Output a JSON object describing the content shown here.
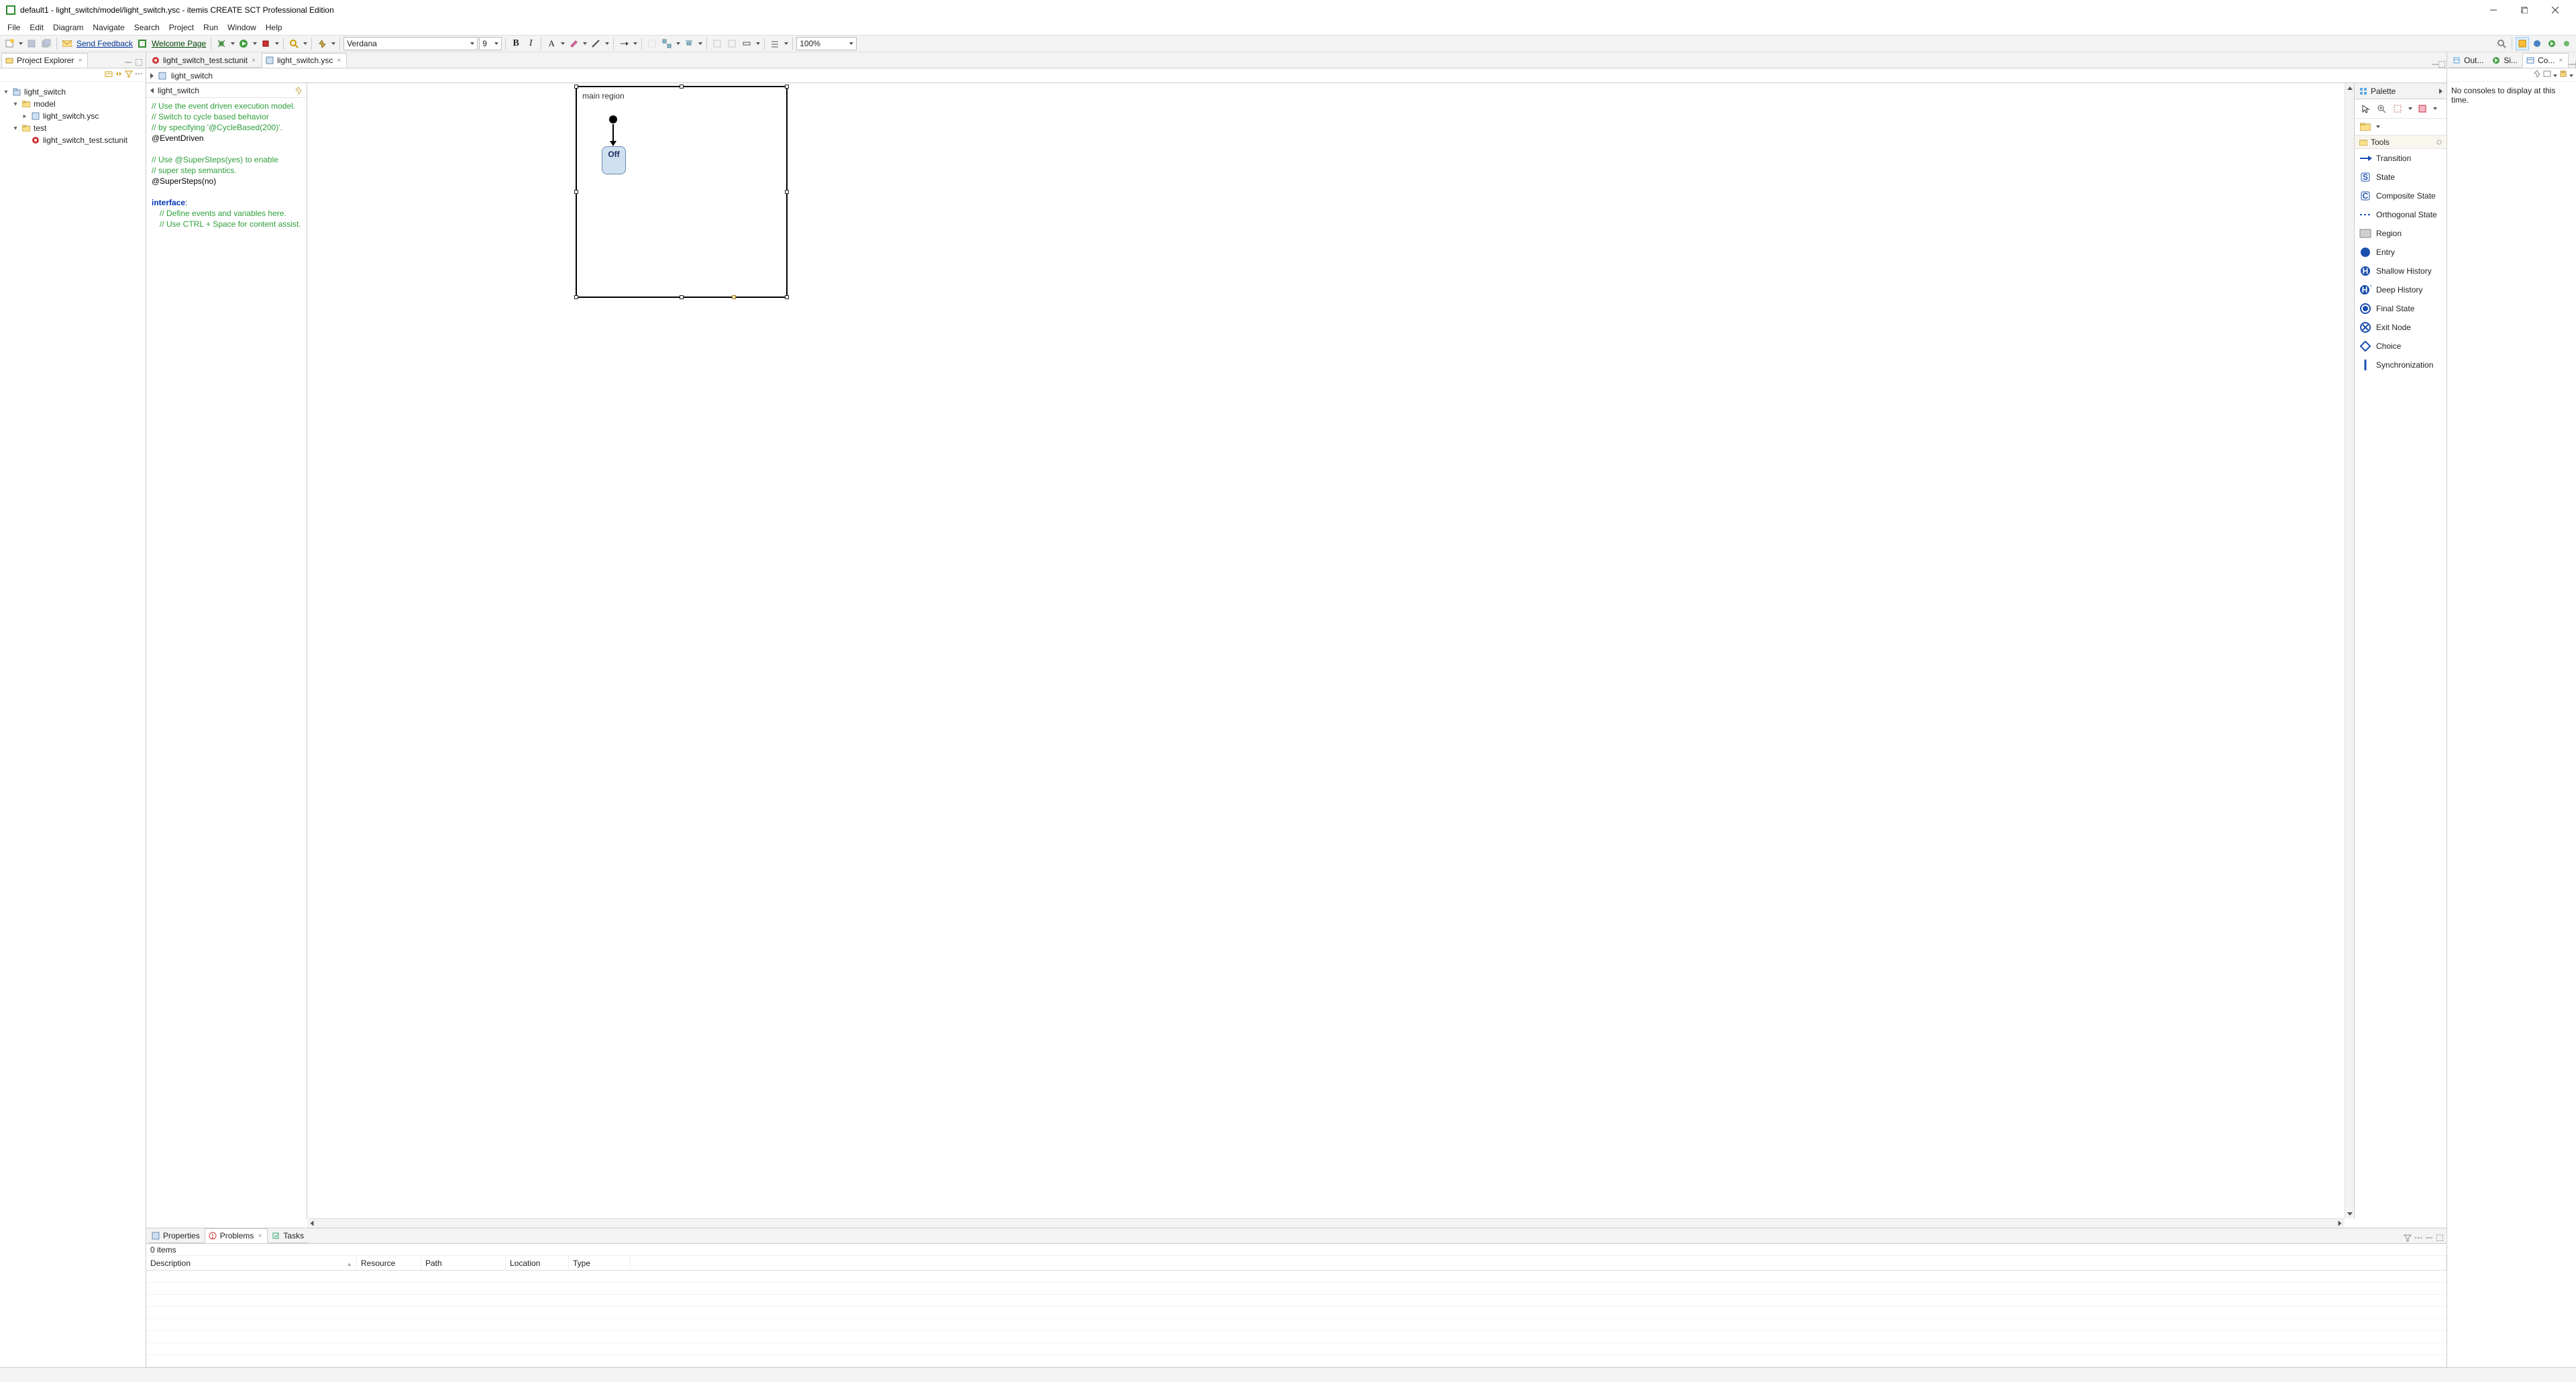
{
  "window": {
    "title": "default1 - light_switch/model/light_switch.ysc - itemis CREATE SCT Professional Edition"
  },
  "menus": [
    "File",
    "Edit",
    "Diagram",
    "Navigate",
    "Search",
    "Project",
    "Run",
    "Window",
    "Help"
  ],
  "toolbar": {
    "send_feedback": "Send Feedback",
    "welcome_page": "Welcome Page",
    "font_family": "Verdana",
    "font_size": "9",
    "zoom": "100%"
  },
  "explorer": {
    "tab": "Project Explorer",
    "tree": {
      "project": "light_switch",
      "folders": [
        {
          "name": "model",
          "children": [
            "light_switch.ysc"
          ]
        },
        {
          "name": "test",
          "children": [
            "light_switch_test.sctunit"
          ]
        }
      ]
    }
  },
  "editor": {
    "tabs": [
      {
        "label": "light_switch_test.sctunit",
        "active": false
      },
      {
        "label": "light_switch.ysc",
        "active": true
      }
    ],
    "breadcrumb": "light_switch",
    "defhead": "light_switch",
    "definition": {
      "lines": [
        {
          "kind": "c",
          "text": "// Use the event driven execution model."
        },
        {
          "kind": "c",
          "text": "// Switch to cycle based behavior"
        },
        {
          "kind": "c",
          "text": "// by specifying '@CycleBased(200)'."
        },
        {
          "kind": "ann",
          "text": "@EventDriven"
        },
        {
          "kind": "blank",
          "text": ""
        },
        {
          "kind": "c",
          "text": "// Use @SuperSteps(yes) to enable"
        },
        {
          "kind": "c",
          "text": "// super step semantics."
        },
        {
          "kind": "ann",
          "text": "@SuperSteps(no)"
        },
        {
          "kind": "blank",
          "text": ""
        },
        {
          "kind": "kw",
          "text": "interface:"
        },
        {
          "kind": "ci",
          "text": "// Define events and variables here."
        },
        {
          "kind": "ci",
          "text": "// Use CTRL + Space for content assist."
        }
      ]
    },
    "region_title": "main region",
    "state_name": "Off"
  },
  "palette": {
    "title": "Palette",
    "tools_label": "Tools",
    "tools": [
      {
        "id": "transition",
        "label": "Transition"
      },
      {
        "id": "state",
        "label": "State"
      },
      {
        "id": "composite",
        "label": "Composite State"
      },
      {
        "id": "orthogonal",
        "label": "Orthogonal State"
      },
      {
        "id": "region",
        "label": "Region"
      },
      {
        "id": "entry",
        "label": "Entry"
      },
      {
        "id": "shallowhist",
        "label": "Shallow History"
      },
      {
        "id": "deephist",
        "label": "Deep History"
      },
      {
        "id": "finalstate",
        "label": "Final State"
      },
      {
        "id": "exitnode",
        "label": "Exit Node"
      },
      {
        "id": "choice",
        "label": "Choice"
      },
      {
        "id": "sync",
        "label": "Synchronization"
      }
    ]
  },
  "bottom_tabs": [
    "Properties",
    "Problems",
    "Tasks"
  ],
  "bottom_active": 1,
  "problems": {
    "count_text": "0 items",
    "columns": [
      "Description",
      "Resource",
      "Path",
      "Location",
      "Type"
    ]
  },
  "right_tabs": [
    "Out...",
    "Si...",
    "Co..."
  ],
  "right_active": 2,
  "console": {
    "body": "No consoles to display at this time."
  }
}
